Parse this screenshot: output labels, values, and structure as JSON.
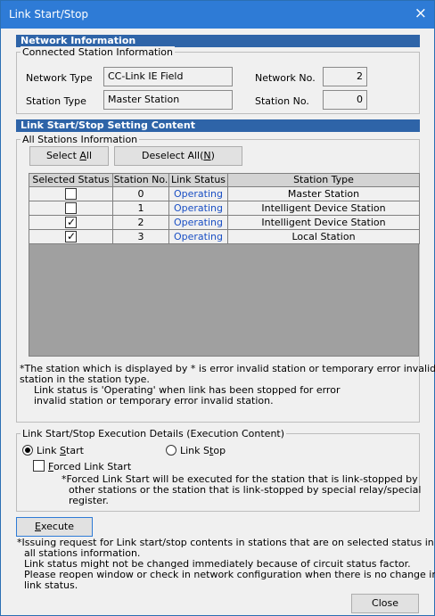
{
  "window": {
    "title": "Link Start/Stop",
    "close_icon": "×"
  },
  "network_info": {
    "header": "Network Information",
    "group_title": "Connected Station Information",
    "network_type_label": "Network Type",
    "network_type_value": "CC-Link IE Field",
    "network_no_label": "Network No.",
    "network_no_value": "2",
    "station_type_label": "Station Type",
    "station_type_value": "Master Station",
    "station_no_label": "Station No.",
    "station_no_value": "0"
  },
  "setting": {
    "header": "Link Start/Stop Setting Content",
    "group_title": "All Stations Information",
    "select_all": {
      "prefix": "Select ",
      "accel": "A",
      "suffix": "ll"
    },
    "deselect_all": {
      "prefix": "Deselect All(",
      "accel": "N",
      "suffix": ")"
    },
    "columns": [
      "Selected Status",
      "Station No.",
      "Link Status",
      "Station Type"
    ],
    "rows": [
      {
        "selected": false,
        "station_no": "0",
        "link_status": "Operating",
        "station_type": "Master Station"
      },
      {
        "selected": false,
        "station_no": "1",
        "link_status": "Operating",
        "station_type": "Intelligent Device Station"
      },
      {
        "selected": true,
        "station_no": "2",
        "link_status": "Operating",
        "station_type": "Intelligent Device Station"
      },
      {
        "selected": true,
        "station_no": "3",
        "link_status": "Operating",
        "station_type": "Local Station"
      }
    ],
    "note1": "*The station which is displayed by * is error invalid station or temporary error invalid",
    "note2": "station in the station type.",
    "note3": "Link status is 'Operating' when link has been stopped for error",
    "note4": "invalid station or temporary error invalid station."
  },
  "execution": {
    "group_title": "Link Start/Stop Execution Details (Execution Content)",
    "link_start": {
      "prefix": "Link ",
      "accel": "S",
      "suffix": "tart",
      "selected": true
    },
    "link_stop": {
      "prefix": "Link S",
      "accel": "t",
      "suffix": "op",
      "selected": false
    },
    "forced": {
      "accel": "F",
      "suffix": "orced Link Start",
      "checked": false
    },
    "forced_note1": "*Forced Link Start will be executed for the station that is link-stopped by",
    "forced_note2": "other stations or the station that is link-stopped by special relay/special",
    "forced_note3": "register."
  },
  "execute_button": {
    "accel": "E",
    "suffix": "xecute"
  },
  "footer": {
    "line1": "*Issuing request for Link start/stop contents in stations that are on selected status in",
    "line2": "all stations information.",
    "line3": "Link status might not be changed immediately because of circuit status factor.",
    "line4": "Please reopen window or check in network configuration when there is no change in",
    "line5": "link status."
  },
  "close_button": "Close",
  "colors": {
    "titlebar": "#2e7bd6",
    "section_header": "#2e64a8",
    "link_status": "#1a4fc4",
    "grid_empty": "#a0a0a0"
  }
}
